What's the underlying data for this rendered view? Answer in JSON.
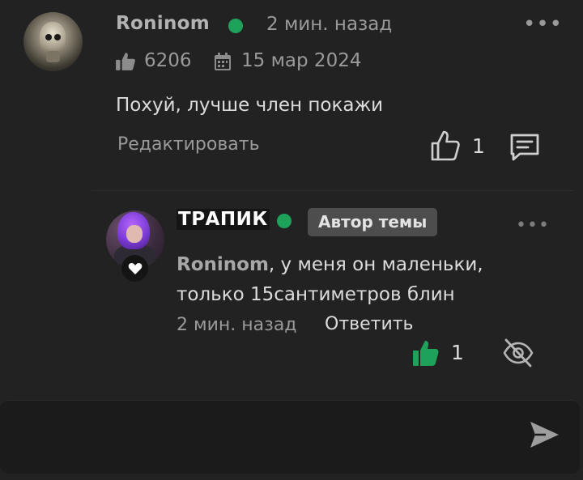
{
  "comment": {
    "author": "Roninom",
    "time": "2 мин. назад",
    "more": "•••",
    "likes_total": "6206",
    "date": "15 мар 2024",
    "text": "Похуй, лучше член покажи",
    "edit_label": "Редактировать",
    "like_count": "1"
  },
  "reply": {
    "author": "ТРАПИК",
    "badge": "Автор темы",
    "more": "•••",
    "mention": "Roninom",
    "text_rest": ", у меня он маленьки, только 15сантиметров блин",
    "time": "2 мин. назад",
    "reply_label": "Ответить",
    "like_count": "1"
  },
  "colors": {
    "background": "#222223",
    "online": "#1ea25a",
    "like_active": "#1ea25a"
  },
  "icons": {
    "online": "online-dot",
    "likes": "thumbs-up-icon",
    "date": "calendar-icon",
    "reply": "chat-bubble-icon",
    "hide": "eye-slash-icon",
    "send": "send-icon",
    "heart": "heart-icon"
  }
}
